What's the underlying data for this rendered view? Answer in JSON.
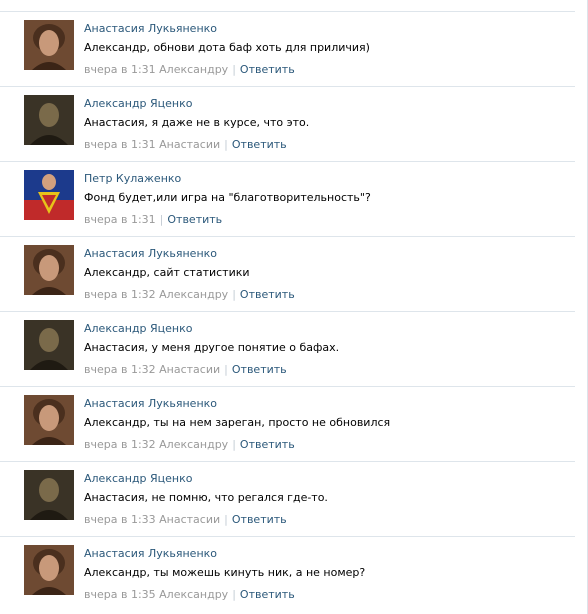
{
  "avatar_colors": {
    "anastasia": "#6e4a32",
    "alexander": "#3a3326",
    "petr": "#1c3a8c"
  },
  "comments": [
    {
      "author": "Анастасия Лукьяненко",
      "text": "Александр, обнови дота баф хоть для приличия)",
      "time": "вчера в 1:31 Александру",
      "reply": "Ответить",
      "avatar": "anastasia"
    },
    {
      "author": "Александр Яценко",
      "text": "Анастасия, я даже не в курсе, что это.",
      "time": "вчера в 1:31 Анастасии",
      "reply": "Ответить",
      "avatar": "alexander"
    },
    {
      "author": "Петр Кулаженко",
      "text": "Фонд будет,или игра на \"благотворительность\"?",
      "time": "вчера в 1:31",
      "reply": "Ответить",
      "avatar": "petr"
    },
    {
      "author": "Анастасия Лукьяненко",
      "text": "Александр, сайт статистики",
      "time": "вчера в 1:32 Александру",
      "reply": "Ответить",
      "avatar": "anastasia"
    },
    {
      "author": "Александр Яценко",
      "text": "Анастасия, у меня другое понятие о бафах.",
      "time": "вчера в 1:32 Анастасии",
      "reply": "Ответить",
      "avatar": "alexander"
    },
    {
      "author": "Анастасия Лукьяненко",
      "text": "Александр, ты на нем зареган, просто не обновился",
      "time": "вчера в 1:32 Александру",
      "reply": "Ответить",
      "avatar": "anastasia"
    },
    {
      "author": "Александр Яценко",
      "text": "Анастасия, не помню, что регался где-то.",
      "time": "вчера в 1:33 Анастасии",
      "reply": "Ответить",
      "avatar": "alexander"
    },
    {
      "author": "Анастасия Лукьяненко",
      "text": "Александр, ты можешь кинуть ник, а не номер?",
      "time": "вчера в 1:35 Александру",
      "reply": "Ответить",
      "avatar": "anastasia"
    }
  ]
}
